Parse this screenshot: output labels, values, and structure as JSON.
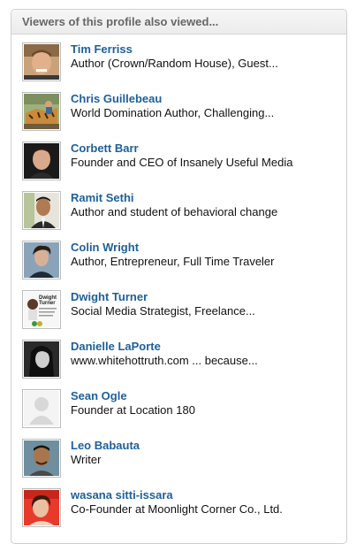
{
  "panel": {
    "title": "Viewers of this profile also viewed...",
    "people": [
      {
        "name": "Tim Ferriss",
        "headline": "Author (Crown/Random House), Guest..."
      },
      {
        "name": "Chris Guillebeau",
        "headline": "World Domination Author, Challenging..."
      },
      {
        "name": "Corbett Barr",
        "headline": "Founder and CEO of Insanely Useful Media"
      },
      {
        "name": "Ramit Sethi",
        "headline": "Author and student of behavioral change"
      },
      {
        "name": "Colin Wright",
        "headline": "Author, Entrepreneur, Full Time Traveler"
      },
      {
        "name": "Dwight Turner",
        "headline": "Social Media Strategist, Freelance..."
      },
      {
        "name": "Danielle LaPorte",
        "headline": "www.whitehottruth.com ... because..."
      },
      {
        "name": "Sean Ogle",
        "headline": "Founder at Location 180"
      },
      {
        "name": "Leo Babauta",
        "headline": "Writer"
      },
      {
        "name": "wasana sitti-issara",
        "headline": "Co-Founder at Moonlight Corner Co., Ltd."
      }
    ],
    "photo_thumbnail_text": {
      "dwight_turner": [
        "Dwight",
        "Turner"
      ]
    }
  },
  "colors": {
    "name_link": "#1e5f9a",
    "headline": "#111111",
    "header_text": "#666666",
    "border": "#cfcfcf"
  }
}
